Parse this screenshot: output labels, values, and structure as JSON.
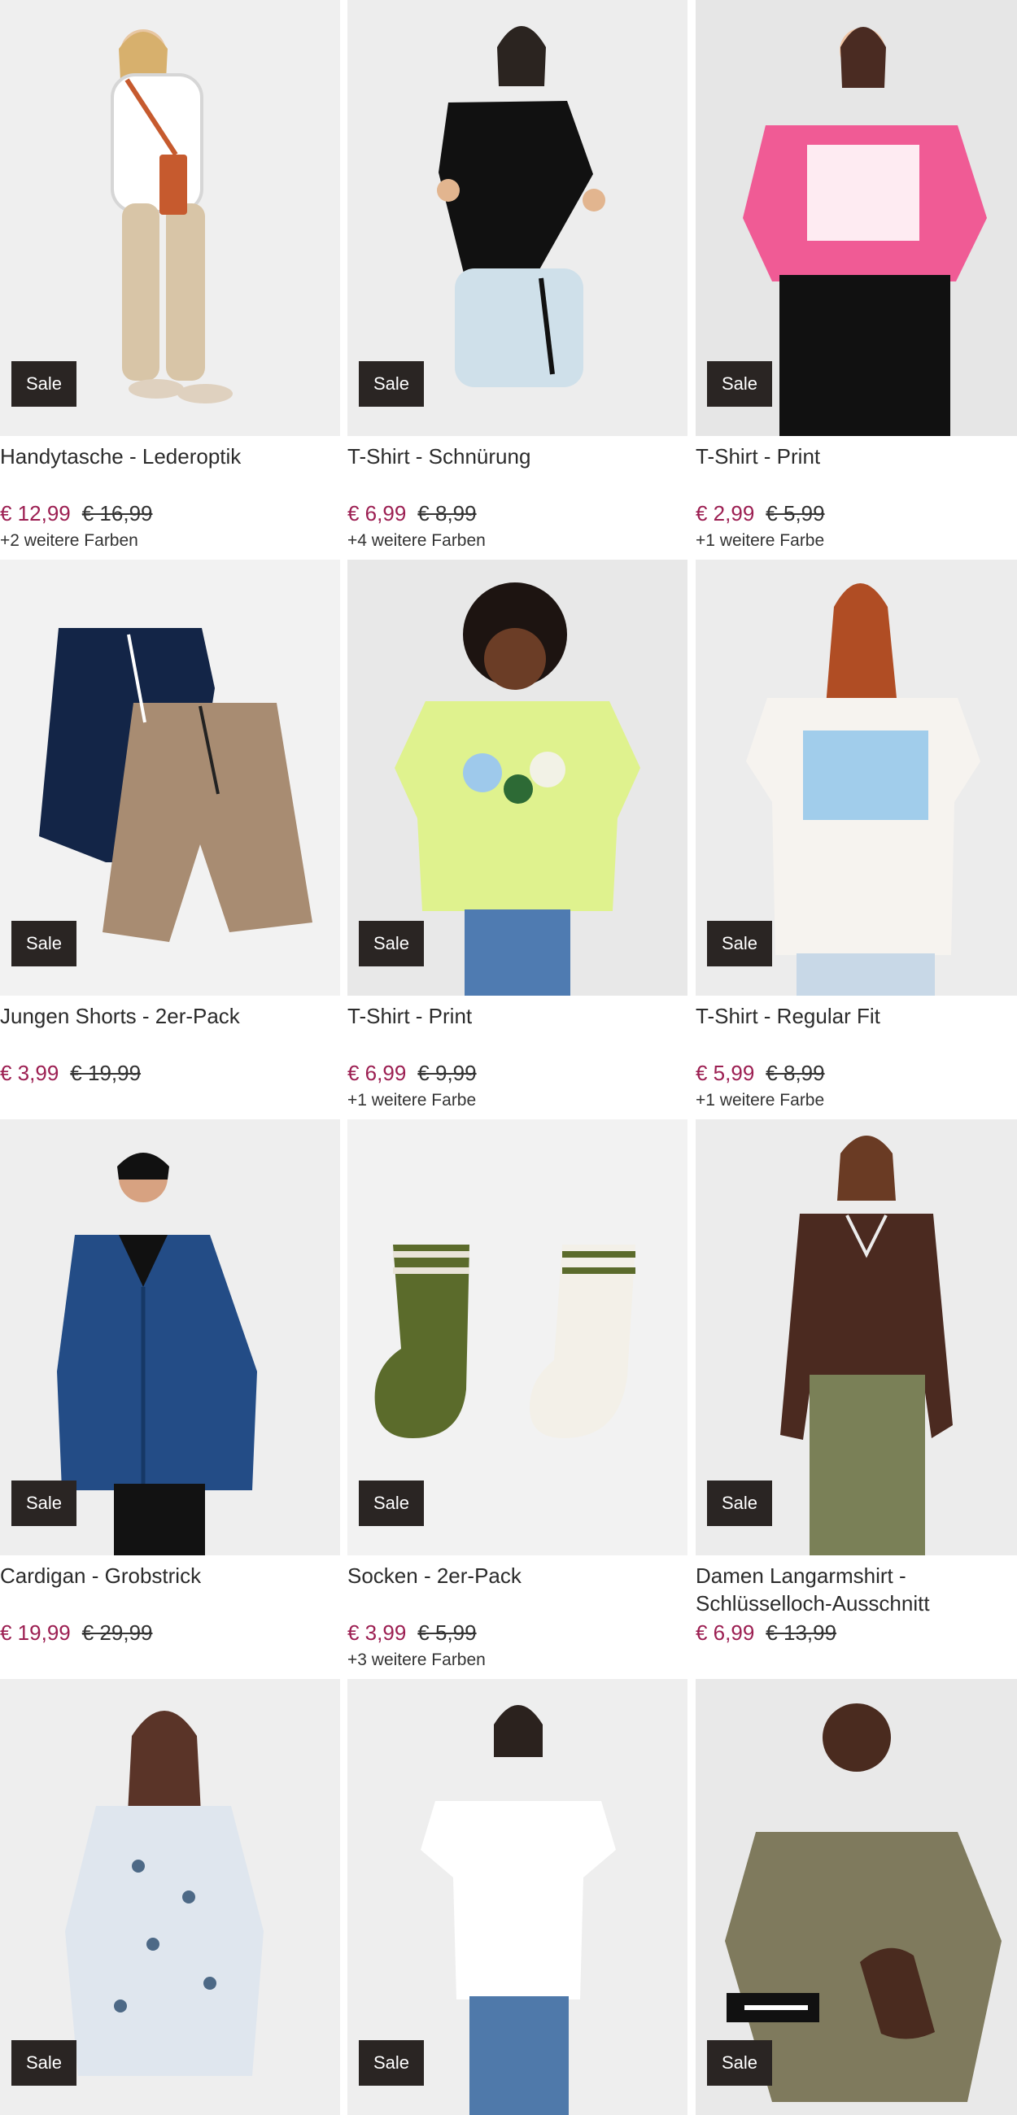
{
  "products": [
    {
      "title": "Handytasche - Lederoptik",
      "badge": "Sale",
      "price": "€ 12,99",
      "old_price": "€ 16,99",
      "colors": "+2 weitere Farben",
      "image_icon": "crossbody-phone-bag-photo",
      "bg": "#efefef",
      "accent": "#c65a2e"
    },
    {
      "title": "T-Shirt - Schnürung",
      "badge": "Sale",
      "price": "€ 6,99",
      "old_price": "€ 8,99",
      "colors": "+4 weitere Farben",
      "image_icon": "black-tshirt-photo",
      "bg": "#ededed",
      "accent": "#111111"
    },
    {
      "title": "T-Shirt - Print",
      "badge": "Sale",
      "price": "€ 2,99",
      "old_price": "€ 5,99",
      "colors": "+1 weitere Farbe",
      "image_icon": "pink-print-tshirt-photo",
      "bg": "#e6e6e6",
      "accent": "#f05b95"
    },
    {
      "title": "Jungen Shorts - 2er-Pack",
      "badge": "Sale",
      "price": "€ 3,99",
      "old_price": "€ 19,99",
      "colors": "",
      "image_icon": "boys-shorts-pack-photo",
      "bg": "#f2f2f2",
      "accent": "#a88c72"
    },
    {
      "title": "T-Shirt - Print",
      "badge": "Sale",
      "price": "€ 6,99",
      "old_price": "€ 9,99",
      "colors": "+1 weitere Farbe",
      "image_icon": "lime-print-tshirt-photo",
      "bg": "#e8e8e8",
      "accent": "#dff28e"
    },
    {
      "title": "T-Shirt - Regular Fit",
      "badge": "Sale",
      "price": "€ 5,99",
      "old_price": "€ 8,99",
      "colors": "+1 weitere Farbe",
      "image_icon": "white-print-tshirt-photo",
      "bg": "#ececec",
      "accent": "#f6f3ef"
    },
    {
      "title": "Cardigan - Grobstrick",
      "badge": "Sale",
      "price": "€ 19,99",
      "old_price": "€ 29,99",
      "colors": "",
      "image_icon": "blue-cardigan-photo",
      "bg": "#eeeeee",
      "accent": "#234c86"
    },
    {
      "title": "Socken - 2er-Pack",
      "badge": "Sale",
      "price": "€ 3,99",
      "old_price": "€ 5,99",
      "colors": "+3 weitere Farben",
      "image_icon": "socks-pack-photo",
      "bg": "#f2f2f2",
      "accent": "#5b6b2b"
    },
    {
      "title": "Damen Langarmshirt - Schlüsselloch-Ausschnitt",
      "badge": "Sale",
      "price": "€ 6,99",
      "old_price": "€ 13,99",
      "colors": "",
      "image_icon": "brown-longsleeve-photo",
      "bg": "#ececec",
      "accent": "#4b2a20"
    },
    {
      "title": "",
      "badge": "Sale",
      "price": "",
      "old_price": "",
      "colors": "",
      "image_icon": "floral-blouse-photo",
      "bg": "#eeeeee",
      "accent": "#9bb0c6"
    },
    {
      "title": "",
      "badge": "Sale",
      "price": "",
      "old_price": "",
      "colors": "",
      "image_icon": "white-tshirt-photo",
      "bg": "#eeeeee",
      "accent": "#ffffff"
    },
    {
      "title": "",
      "badge": "Sale",
      "price": "",
      "old_price": "",
      "colors": "",
      "image_icon": "olive-tshirt-photo",
      "bg": "#e9e9e9",
      "accent": "#7f7a5d"
    }
  ]
}
